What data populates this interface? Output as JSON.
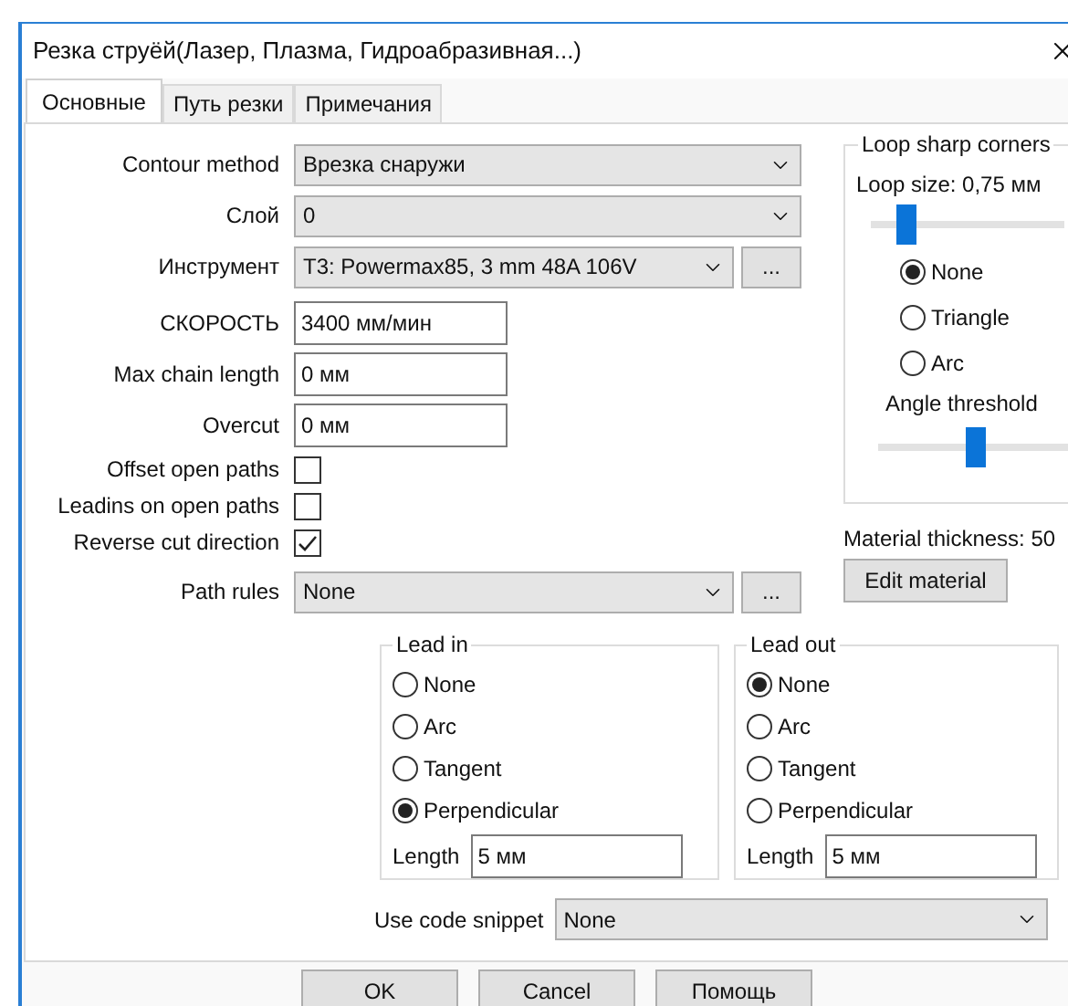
{
  "window": {
    "title": "Резка струёй(Лазер, Плазма, Гидроабразивная...)"
  },
  "tabs": [
    {
      "label": "Основные",
      "selected": true
    },
    {
      "label": "Путь резки",
      "selected": false
    },
    {
      "label": "Примечания",
      "selected": false
    }
  ],
  "fields": [
    {
      "kind": "combo",
      "label": "Contour method",
      "value": "Врезка снаружи"
    },
    {
      "kind": "combo",
      "label": "Слой",
      "value": "0"
    },
    {
      "kind": "combo",
      "label": "Инструмент",
      "value": "T3: Powermax85, 3 mm 48A 106V",
      "button": "..."
    },
    {
      "kind": "input",
      "label": "СКОРОСТЬ",
      "value": "3400 мм/мин"
    },
    {
      "kind": "input",
      "label": "Max chain length",
      "value": "0 мм"
    },
    {
      "kind": "input",
      "label": "Overcut",
      "value": "0 мм"
    },
    {
      "kind": "checkbox",
      "label": "Offset open paths",
      "checked": false
    },
    {
      "kind": "checkbox",
      "label": "Leadins on open paths",
      "checked": false
    },
    {
      "kind": "checkbox",
      "label": "Reverse cut direction",
      "checked": true
    },
    {
      "kind": "combo",
      "label": "Path rules",
      "value": "None",
      "button": "..."
    }
  ],
  "loop_group": {
    "title": "Loop sharp corners",
    "loop_size": "Loop size: 0,75 мм",
    "loop_slider": {
      "level": 0.15
    },
    "options": [
      {
        "label": "None",
        "selected": true
      },
      {
        "label": "Triangle",
        "selected": false
      },
      {
        "label": "Arc",
        "selected": false
      }
    ],
    "angle_label": "Angle threshold",
    "angle_slider": {
      "level": 0.5
    }
  },
  "material_thickness": "Material thickness: 50",
  "edit_material_button": "Edit material",
  "lead_groups": [
    {
      "title": "Lead in",
      "options": [
        {
          "label": "None",
          "selected": false
        },
        {
          "label": "Arc",
          "selected": false
        },
        {
          "label": "Tangent",
          "selected": false
        },
        {
          "label": "Perpendicular",
          "selected": true
        }
      ],
      "length_label": "Length",
      "length_value": "5 мм"
    },
    {
      "title": "Lead out",
      "options": [
        {
          "label": "None",
          "selected": true
        },
        {
          "label": "Arc",
          "selected": false
        },
        {
          "label": "Tangent",
          "selected": false
        },
        {
          "label": "Perpendicular",
          "selected": false
        }
      ],
      "length_label": "Length",
      "length_value": "5 мм"
    }
  ],
  "snippet": {
    "label": "Use code snippet",
    "value": "None"
  },
  "buttons": [
    "OK",
    "Cancel",
    "Помощь"
  ]
}
